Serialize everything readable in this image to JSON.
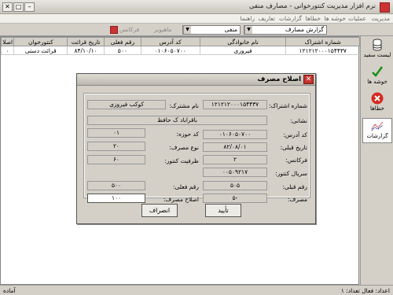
{
  "app": {
    "title": "نرم افزار مدیریت کنتورخوانی - مصارف منفی"
  },
  "menu": [
    "مدیریت",
    "عملیات",
    "خوشه ها",
    "خطاها",
    "گزارشات",
    "تعاریف",
    "راهنما"
  ],
  "toolbar": {
    "report_type": "گزارش مصارف",
    "filter_value": "منفی",
    "disabled_label_1": "فرکانس",
    "disabled_label_2": "ماهیوبر"
  },
  "sidebar": {
    "items": [
      {
        "label": "لیست سفید"
      },
      {
        "label": "خوشه ها"
      },
      {
        "label": "خطاها"
      },
      {
        "label": "گزارشات"
      }
    ]
  },
  "table": {
    "columns": [
      "شماره اشتراک",
      "نام خانوادگی",
      "کد آدرس",
      "رقم فعلی",
      "تاریخ قرائت",
      "کنتورخوان",
      "اصلا"
    ],
    "rows": [
      [
        "۱۲۱۲۱۲۰۰۰۱۵۴۴۳۷",
        "فیروزی",
        "۰۱۰۶۰۵۰۷۰۰",
        "۵۰۰",
        "۸۴/۱۰/۱۰",
        "قرائت دستی",
        "۰"
      ]
    ]
  },
  "dialog": {
    "title": "اصلاح مصرف",
    "labels": {
      "subscription": "شماره اشتراک:",
      "subscriber_name": "نام مشترک:",
      "address": "نشانی:",
      "address_code": "کد آدرس:",
      "zone_code": "کد حوزه:",
      "prev_date": "تاریخ قبلی:",
      "usage_type": "نوع مصرف:",
      "frequency": "فرکانس:",
      "meter_capacity": "ظرفیت کنتور:",
      "meter_serial": "سریال کنتور:",
      "prev_reading": "رقم قبلی:",
      "current_reading": "رقم فعلی:",
      "consumption": "مصرف:",
      "correct_consumption": "اصلاح مصرف:"
    },
    "values": {
      "subscription": "۱۲۱۲۱۲۰۰۰۱۵۴۴۳۷",
      "subscriber_name": "کوکب فیروزی",
      "address": "باقراباد ک حافظ",
      "address_code": "۰۱۰۶۰۵۰۷۰۰",
      "zone_code": "۰۱",
      "prev_date": "۸۲/۰۸/۰۱",
      "usage_type": "۲۰",
      "frequency": "۲",
      "meter_capacity": "۶۰",
      "meter_serial": "۰۰۵۰۹۲۱۷",
      "prev_reading": "۵۰۵",
      "current_reading": "۵۰۰",
      "consumption": "-۵",
      "correct_consumption": "۱۰۰"
    },
    "buttons": {
      "confirm": "تأیید",
      "cancel": "انصراف"
    }
  },
  "status": {
    "left": "آماده",
    "right": "اعداد: فعال   تعداد: ۱"
  }
}
